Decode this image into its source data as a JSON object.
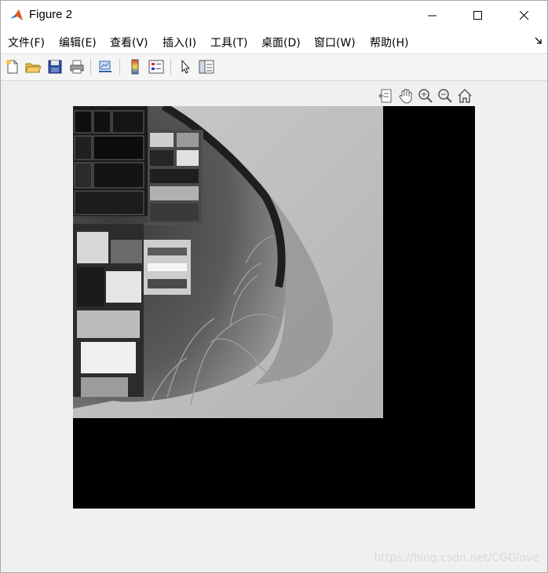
{
  "window": {
    "title": "Figure 2"
  },
  "menu": {
    "items": [
      "文件(F)",
      "编辑(E)",
      "查看(V)",
      "插入(I)",
      "工具(T)",
      "桌面(D)",
      "窗口(W)",
      "帮助(H)"
    ]
  },
  "toolbar": {
    "icons": [
      "new-figure-icon",
      "open-file-icon",
      "save-icon",
      "print-icon",
      "link-plot-icon",
      "colorbar-icon",
      "legend-icon",
      "pointer-icon",
      "property-inspector-icon"
    ]
  },
  "axes_toolbar": {
    "icons": [
      "export-icon",
      "pan-icon",
      "zoom-in-icon",
      "zoom-out-icon",
      "home-icon"
    ]
  },
  "watermark": "https://blog.csdn.net/CGGlove"
}
